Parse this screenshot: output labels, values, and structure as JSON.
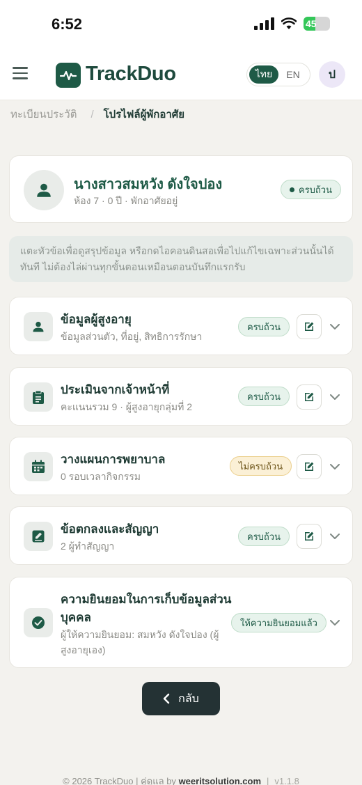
{
  "status": {
    "time": "6:52",
    "battery": "45"
  },
  "header": {
    "app_name": "TrackDuo",
    "lang_th": "ไทย",
    "lang_en": "EN",
    "user_initial": "ป"
  },
  "breadcrumb": {
    "parent": "ทะเบียนประวัติ",
    "separator": "/",
    "current": "โปรไฟล์ผู้พักอาศัย"
  },
  "profile": {
    "name": "นางสาวสมหวัง ดังใจปอง",
    "subtitle": "ห้อง 7 · 0 ปี · พักอาศัยอยู่",
    "badge": "ครบถ้วน"
  },
  "info_text": "แตะหัวข้อเพื่อดูสรุปข้อมูล หรือกดไอคอนดินสอเพื่อไปแก้ไขเฉพาะส่วนนั้นได้ทันที ไม่ต้องไล่ผ่านทุกขั้นตอนเหมือนตอนบันทึกแรกรับ",
  "sections": [
    {
      "title": "ข้อมูลผู้สูงอายุ",
      "subtitle": "ข้อมูลส่วนตัว, ที่อยู่, สิทธิการรักษา",
      "badge": "ครบถ้วน",
      "icon": "person-icon"
    },
    {
      "title": "ประเมินจากเจ้าหน้าที่",
      "subtitle": "คะแนนรวม 9 · ผู้สูงอายุกลุ่มที่ 2",
      "badge": "ครบถ้วน",
      "icon": "clipboard-icon"
    },
    {
      "title": "วางแผนการพยาบาล",
      "subtitle": "0 รอบเวลากิจกรรม",
      "badge": "ไม่ครบถ้วน",
      "icon": "calendar-icon"
    },
    {
      "title": "ข้อตกลงและสัญญา",
      "subtitle": "2 ผู้ทำสัญญา",
      "badge": "ครบถ้วน",
      "icon": "sign-icon"
    },
    {
      "title_line1": "ความยินยอมในการเก็บข้อมูลส่วน",
      "title_line2": "บุคคล",
      "subtitle_line1": "ผู้ให้ความยินยอม: สมหวัง ดังใจปอง (ผู้",
      "subtitle_line2": "สูงอายุเอง)",
      "badge": "ให้ความยินยอมแล้ว",
      "icon": "check-circle-icon"
    }
  ],
  "back_label": "กลับ",
  "footer": {
    "copyright": "© 2026 TrackDuo | คู่ดูแล by ",
    "company": "weeritsolution.com",
    "version": "v1.1.8"
  },
  "colors": {
    "primary": "#1e5a46",
    "ok_bg": "#e7f3ec",
    "warn_bg": "#fbf0d6",
    "page_bg": "#f3f2ee"
  }
}
